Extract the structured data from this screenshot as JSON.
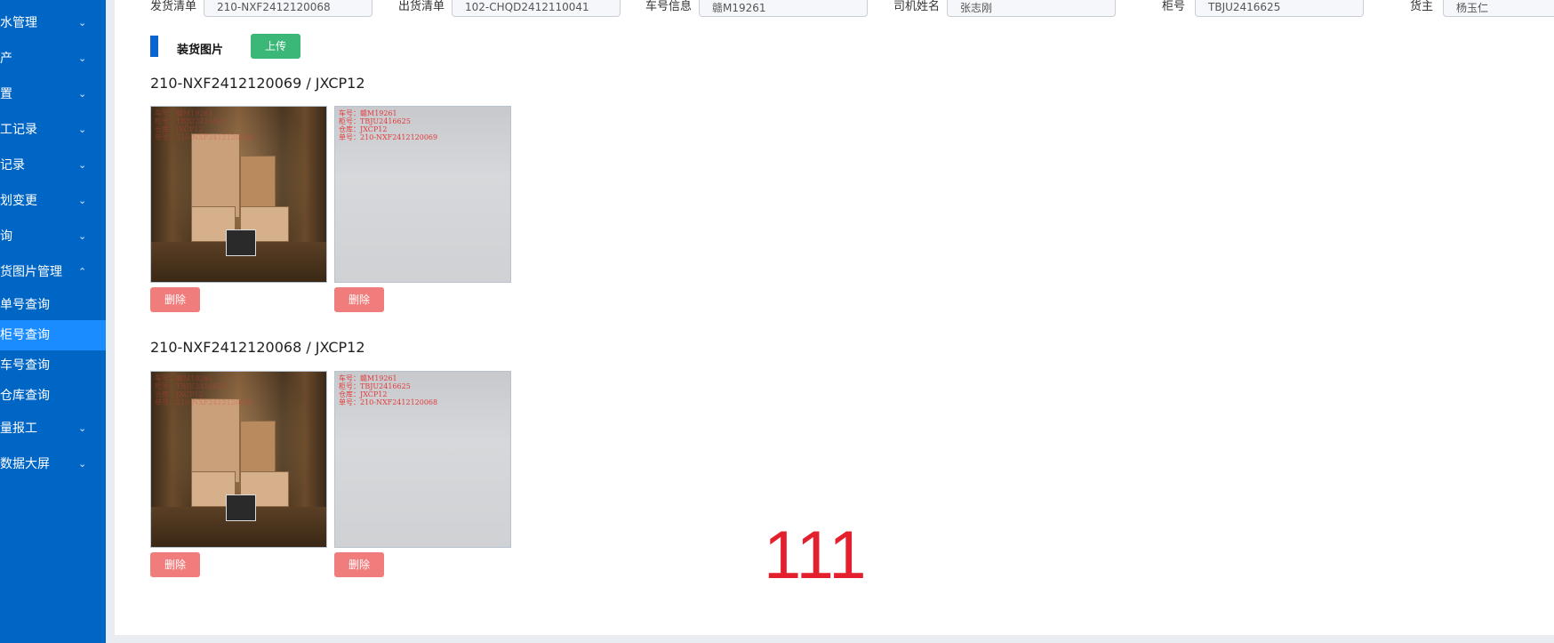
{
  "sidebar": {
    "items": [
      {
        "label": "水管理",
        "chevron": "chevron-down-icon"
      },
      {
        "label": "产",
        "chevron": "chevron-down-icon"
      },
      {
        "label": "置",
        "chevron": "chevron-down-icon"
      },
      {
        "label": "工记录",
        "chevron": "chevron-down-icon"
      },
      {
        "label": "记录",
        "chevron": "chevron-down-icon"
      },
      {
        "label": "划变更",
        "chevron": "chevron-down-icon"
      },
      {
        "label": "询",
        "chevron": "chevron-down-icon"
      },
      {
        "label": "货图片管理",
        "chevron": "chevron-up-icon"
      }
    ],
    "sub_items": [
      {
        "label": "单号查询",
        "active": false
      },
      {
        "label": "柜号查询",
        "active": true
      },
      {
        "label": "车号查询",
        "active": false
      },
      {
        "label": "仓库查询",
        "active": false
      }
    ],
    "after_items": [
      {
        "label": "量报工",
        "chevron": "chevron-down-icon"
      },
      {
        "label": "数据大屏",
        "chevron": "chevron-down-icon"
      }
    ]
  },
  "filters": {
    "shipment_list": {
      "label": "发货清单",
      "value": "210-NXF2412120068"
    },
    "outbound_list": {
      "label": "出货清单",
      "value": "102-CHQD2412110041"
    },
    "vehicle_info": {
      "label": "车号信息",
      "value": "赣M19261"
    },
    "driver_name": {
      "label": "司机姓名",
      "value": "张志刚"
    },
    "container_no": {
      "label": "柜号",
      "value": "TBJU2416625"
    },
    "owner": {
      "label": "货主",
      "value": "杨玉仁"
    }
  },
  "section": {
    "title": "装货图片",
    "upload_label": "上传"
  },
  "groups": [
    {
      "title": "210-NXF2412120069 / JXCP12",
      "photo1_watermark": "车号：赣M19261\n柜号：TBJU2416625\n仓库：JXCP12\n单号：210-NXF2412120069",
      "photo2_watermark": "车号：赣M19261\n柜号：TBJU2416625\n仓库：JXCP12\n单号：210-NXF2412120069",
      "delete_label": "删除"
    },
    {
      "title": "210-NXF2412120068 / JXCP12",
      "photo1_watermark": "车号：赣M19261\n柜号：TBJU2416625\n仓库：JXCP12\n单号：210-NXF2412120068",
      "photo2_watermark": "车号：赣M19261\n柜号：TBJU2416625\n仓库：JXCP12\n单号：210-NXF2412120068",
      "delete_label": "删除"
    }
  ],
  "overlay_number": "111",
  "colors": {
    "sidebar": "#0066c5",
    "active_item": "#1b8cff",
    "upload_button": "#3bb878",
    "delete_button": "#f07c7c",
    "overlay_text": "#e4202e"
  }
}
